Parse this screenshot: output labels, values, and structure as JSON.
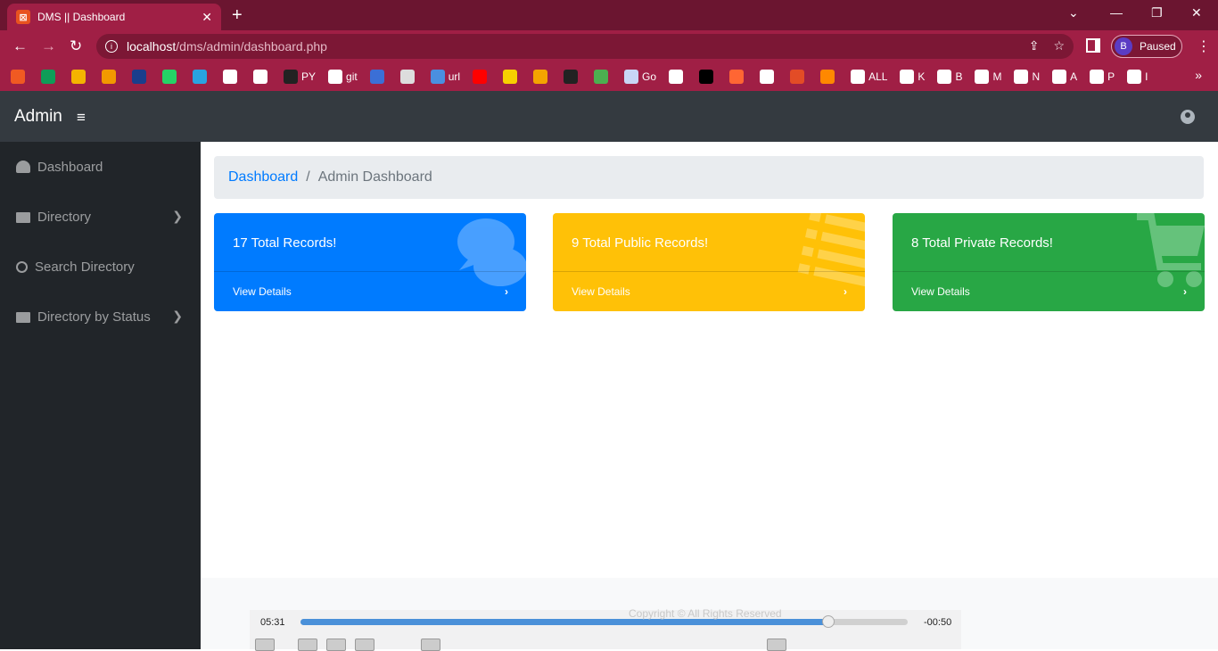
{
  "browser": {
    "tab_title": "DMS || Dashboard",
    "tab_favicon": "xampp-icon",
    "url_host": "localhost",
    "url_path": "/dms/admin/dashboard.php",
    "profile_initial": "B",
    "profile_status": "Paused",
    "bookmarks": [
      {
        "label": "",
        "color": "#f05a22"
      },
      {
        "label": "",
        "color": "#0f9d58"
      },
      {
        "label": "",
        "color": "#f4b400"
      },
      {
        "label": "",
        "color": "#f29900"
      },
      {
        "label": "",
        "color": "#1a3e8c"
      },
      {
        "label": "",
        "color": "#25d366"
      },
      {
        "label": "",
        "color": "#2aa3e0"
      },
      {
        "label": "",
        "color": "#ffffff"
      },
      {
        "label": "",
        "color": "#ffffff"
      },
      {
        "label": "PY",
        "color": "#222222"
      },
      {
        "label": "git",
        "color": "#ffffff"
      },
      {
        "label": "",
        "color": "#3b6fd6"
      },
      {
        "label": "",
        "color": "#dddddd"
      },
      {
        "label": "url",
        "color": "#4a8fe0"
      },
      {
        "label": "",
        "color": "#ff0000"
      },
      {
        "label": "",
        "color": "#f7d000"
      },
      {
        "label": "",
        "color": "#f4a400"
      },
      {
        "label": "",
        "color": "#222222"
      },
      {
        "label": "",
        "color": "#4caf50"
      },
      {
        "label": "Go",
        "color": "#c8d6f5"
      },
      {
        "label": "",
        "color": "#ffffff"
      },
      {
        "label": "",
        "color": "#000000"
      },
      {
        "label": "",
        "color": "#ff6633"
      },
      {
        "label": "",
        "color": "#ffffff"
      },
      {
        "label": "",
        "color": "#e34c26"
      },
      {
        "label": "",
        "color": "#ff8800"
      },
      {
        "label": "ALL",
        "color": "#ffffff"
      },
      {
        "label": "K",
        "color": "#ffffff"
      },
      {
        "label": "B",
        "color": "#ffffff"
      },
      {
        "label": "M",
        "color": "#ffffff"
      },
      {
        "label": "N",
        "color": "#ffffff"
      },
      {
        "label": "A",
        "color": "#ffffff"
      },
      {
        "label": "P",
        "color": "#ffffff"
      },
      {
        "label": "I",
        "color": "#ffffff"
      }
    ]
  },
  "app": {
    "brand": "Admin",
    "sidebar": [
      {
        "label": "Dashboard",
        "icon": "tachometer-icon",
        "has_submenu": false
      },
      {
        "label": "Directory",
        "icon": "folder-icon",
        "has_submenu": true
      },
      {
        "label": "Search Directory",
        "icon": "search-icon",
        "has_submenu": false
      },
      {
        "label": "Directory by Status",
        "icon": "folder-icon",
        "has_submenu": true
      }
    ],
    "breadcrumb": {
      "link": "Dashboard",
      "current": "Admin Dashboard"
    },
    "cards": [
      {
        "title": "17 Total Records!",
        "footer": "View Details",
        "color": "#007bff",
        "icon": "comments-icon"
      },
      {
        "title": "9 Total Public Records!",
        "footer": "View Details",
        "color": "#ffc107",
        "icon": "list-icon"
      },
      {
        "title": "8 Total Private Records!",
        "footer": "View Details",
        "color": "#28a745",
        "icon": "shopping-cart-icon"
      }
    ],
    "footer_text": "Copyright © All Rights Reserved"
  },
  "player": {
    "elapsed": "05:31",
    "remaining": "-00:50",
    "progress": 0.87
  }
}
